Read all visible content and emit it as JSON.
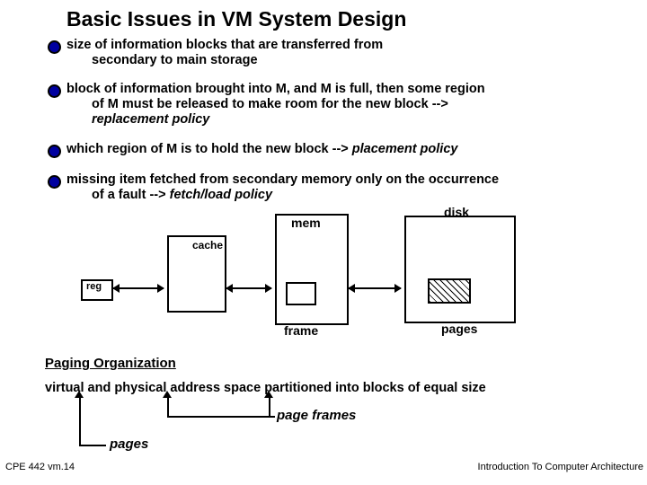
{
  "title": "Basic Issues in VM System Design",
  "bullets": [
    "size of information blocks that are transferred from\nsecondary to main storage",
    "block of information brought into M, and M is full, then some region\nof M must be released to make room for the new block -->\n",
    "which region of M is to hold the new block -->  ",
    "missing item fetched from secondary memory only on the occurrence\nof a fault  -->  "
  ],
  "italic_terms": {
    "replacement": "replacement policy",
    "placement": "placement policy",
    "fetch": "fetch/load policy"
  },
  "diagram": {
    "reg": "reg",
    "cache": "cache",
    "mem": "mem",
    "frame": "frame",
    "disk": "disk",
    "pages": "pages"
  },
  "paging": {
    "heading": "Paging Organization",
    "para": "virtual and physical address space partitioned into blocks of equal size",
    "page_frames": "page frames",
    "pages": "pages"
  },
  "footer": {
    "left": "CPE 442  vm.14",
    "right": "Introduction To Computer Architecture"
  }
}
